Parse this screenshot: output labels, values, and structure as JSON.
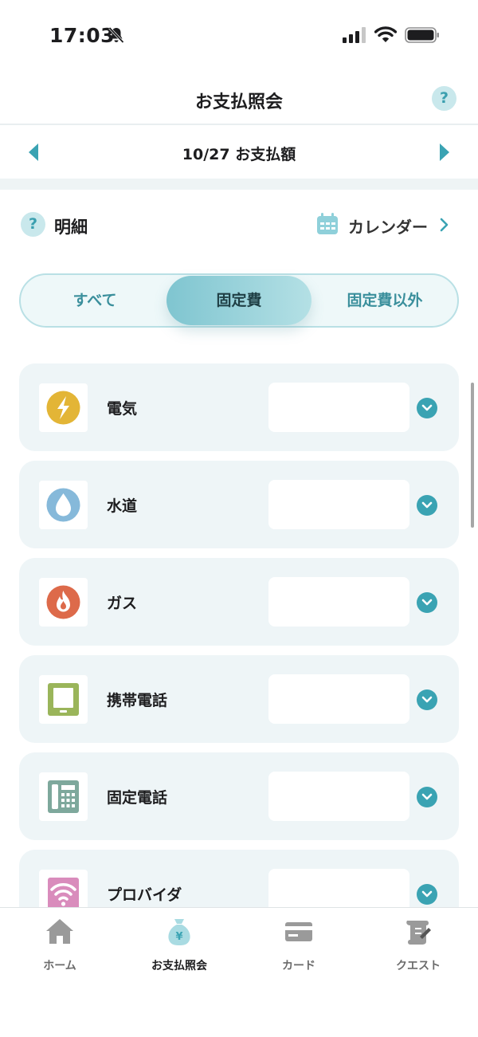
{
  "status_bar": {
    "time": "17:03",
    "icons": [
      "bell-slash-icon",
      "cellular-signal-icon",
      "wifi-icon",
      "battery-icon"
    ]
  },
  "nav": {
    "title": "お支払照会",
    "help_label": "?"
  },
  "date_selector": {
    "title": "10/27 お支払額",
    "prev_icon": "triangle-left-icon",
    "next_icon": "triangle-right-icon"
  },
  "detail": {
    "help_label": "?",
    "label": "明細",
    "calendar_label": "カレンダー"
  },
  "segments": {
    "all": "すべて",
    "fixed": "固定費",
    "other": "固定費以外",
    "selected": "fixed"
  },
  "items": [
    {
      "label": "電気",
      "icon": "lightning-icon"
    },
    {
      "label": "水道",
      "icon": "water-drop-icon"
    },
    {
      "label": "ガス",
      "icon": "flame-icon"
    },
    {
      "label": "携帯電話",
      "icon": "mobile-phone-icon"
    },
    {
      "label": "固定電話",
      "icon": "landline-phone-icon"
    },
    {
      "label": "プロバイダ",
      "icon": "wifi-router-icon"
    }
  ],
  "tabs": [
    {
      "label": "ホーム",
      "icon": "house-icon",
      "active": false
    },
    {
      "label": "お支払照会",
      "icon": "money-bag-icon",
      "active": true
    },
    {
      "label": "カード",
      "icon": "credit-card-icon",
      "active": false
    },
    {
      "label": "クエスト",
      "icon": "scroll-quest-icon",
      "active": false
    }
  ],
  "colors": {
    "accent": "#3aa3b3",
    "segment_active": "#7fc5d0",
    "card_bg": "#eef5f7",
    "electricity": "#e3b536",
    "water": "#86b9da",
    "gas": "#dd6a4a",
    "mobile": "#9ab55a",
    "landline": "#7ea89c",
    "provider": "#d98cbc"
  }
}
